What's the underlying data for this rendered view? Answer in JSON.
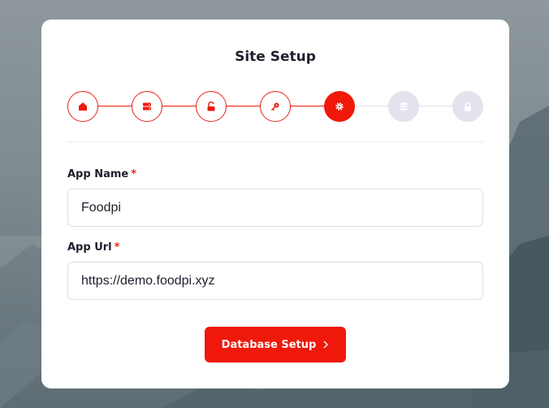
{
  "page": {
    "title": "Site Setup"
  },
  "stepper": {
    "steps": [
      {
        "icon": "home-icon",
        "status": "done"
      },
      {
        "icon": "server-icon",
        "status": "done"
      },
      {
        "icon": "unlock-icon",
        "status": "done"
      },
      {
        "icon": "key-icon",
        "status": "done"
      },
      {
        "icon": "gear-icon",
        "status": "active"
      },
      {
        "icon": "database-icon",
        "status": "pending"
      },
      {
        "icon": "lock-icon",
        "status": "pending"
      }
    ]
  },
  "form": {
    "app_name": {
      "label": "App Name",
      "required_mark": "*",
      "value": "Foodpi"
    },
    "app_url": {
      "label": "App Url",
      "required_mark": "*",
      "value": "https://demo.foodpi.xyz"
    }
  },
  "actions": {
    "next_label": "Database Setup"
  },
  "colors": {
    "accent": "#f0180b",
    "pending": "#e2e3ec",
    "text": "#1f1f2e"
  }
}
